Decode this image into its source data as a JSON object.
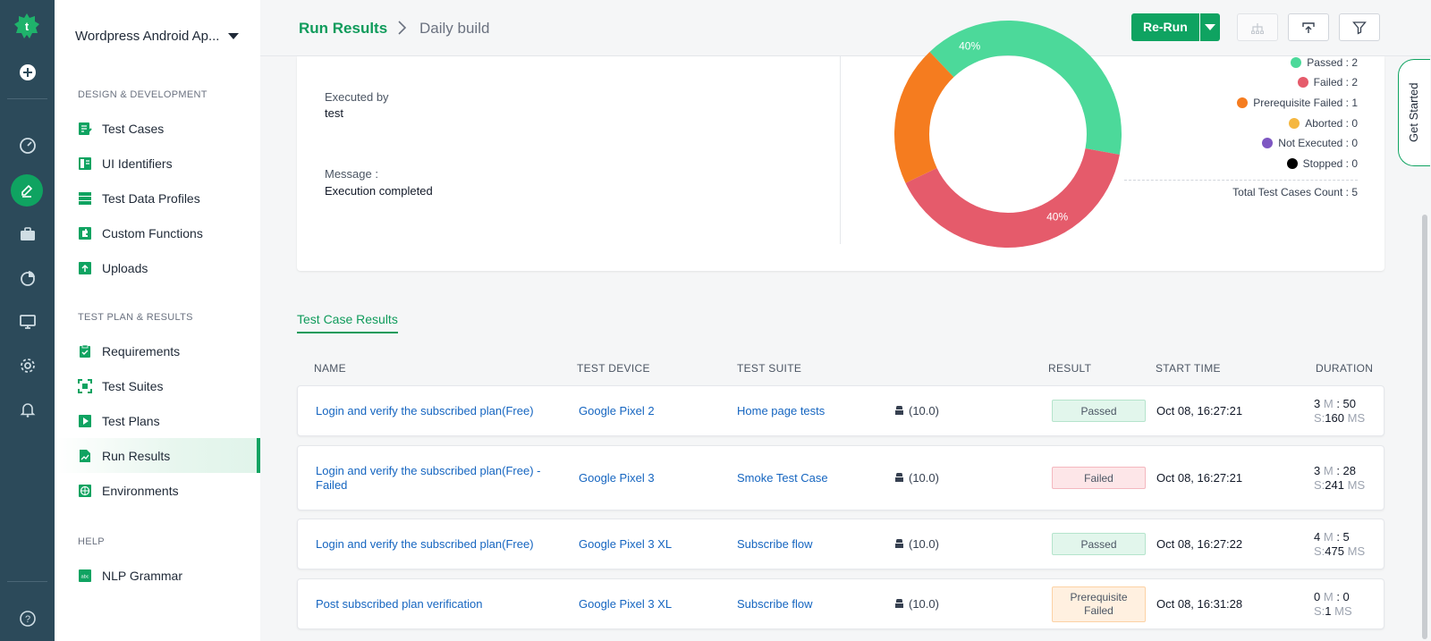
{
  "colors": {
    "accent": "#0fa361",
    "rail": "#2c4a5a",
    "link": "#1565c0",
    "passed": "#4cd99a",
    "failed": "#e55b6b",
    "prerequisite_failed": "#f57c1f",
    "aborted": "#f5b740",
    "not_executed": "#7e57c2",
    "stopped": "#000000"
  },
  "sidebar": {
    "project": "Wordpress Android Ap...",
    "sections": [
      {
        "title": "DESIGN & DEVELOPMENT",
        "items": [
          "Test Cases",
          "UI Identifiers",
          "Test Data Profiles",
          "Custom Functions",
          "Uploads"
        ]
      },
      {
        "title": "TEST PLAN & RESULTS",
        "items": [
          "Requirements",
          "Test Suites",
          "Test Plans",
          "Run Results",
          "Environments"
        ]
      },
      {
        "title": "HELP",
        "items": [
          "NLP Grammar"
        ]
      }
    ]
  },
  "header": {
    "crumb_primary": "Run Results",
    "crumb_secondary": "Daily build",
    "rerun_label": "Re-Run"
  },
  "summary": {
    "executed_by_label": "Executed by",
    "executed_by_value": "test",
    "message_label": "Message :",
    "message_value": "Execution completed",
    "donut_labels": [
      "40%",
      "40%"
    ],
    "legend": [
      "Passed : 2",
      "Failed : 2",
      "Prerequisite Failed : 1",
      "Aborted : 0",
      "Not Executed : 0",
      "Stopped : 0"
    ],
    "total": "Total Test Cases Count : 5",
    "counts": {
      "passed": 2,
      "failed": 2,
      "prerequisite_failed": 1,
      "aborted": 0,
      "not_executed": 0,
      "stopped": 0
    }
  },
  "results": {
    "tab": "Test Case Results",
    "columns": [
      "NAME",
      "TEST DEVICE",
      "TEST SUITE",
      "RESULT",
      "START TIME",
      "DURATION"
    ],
    "rows": [
      {
        "name": "Login and verify the subscribed plan(Free)",
        "device": "Google Pixel 2",
        "suite": "Home page tests",
        "os": "(10.0)",
        "result": "Passed",
        "start": "Oct 08, 16:27:21",
        "min": "3",
        "sec": "50",
        "s": "160"
      },
      {
        "name": "Login and verify the subscribed plan(Free) - Failed",
        "device": "Google Pixel 3",
        "suite": "Smoke Test Case",
        "os": "(10.0)",
        "result": "Failed",
        "start": "Oct 08, 16:27:21",
        "min": "3",
        "sec": "28",
        "s": "241"
      },
      {
        "name": "Login and verify the subscribed plan(Free)",
        "device": "Google Pixel 3 XL",
        "suite": "Subscribe flow",
        "os": "(10.0)",
        "result": "Passed",
        "start": "Oct 08, 16:27:22",
        "min": "4",
        "sec": "5",
        "s": "475"
      },
      {
        "name": "Post subscribed plan verification",
        "device": "Google Pixel 3 XL",
        "suite": "Subscribe flow",
        "os": "(10.0)",
        "result": "Prerequisite Failed",
        "start": "Oct 08, 16:31:28",
        "min": "0",
        "sec": "0",
        "s": "1"
      }
    ],
    "duration_units": {
      "m": "M",
      "ms": "MS",
      "s": "S:"
    }
  },
  "get_started": "Get Started"
}
